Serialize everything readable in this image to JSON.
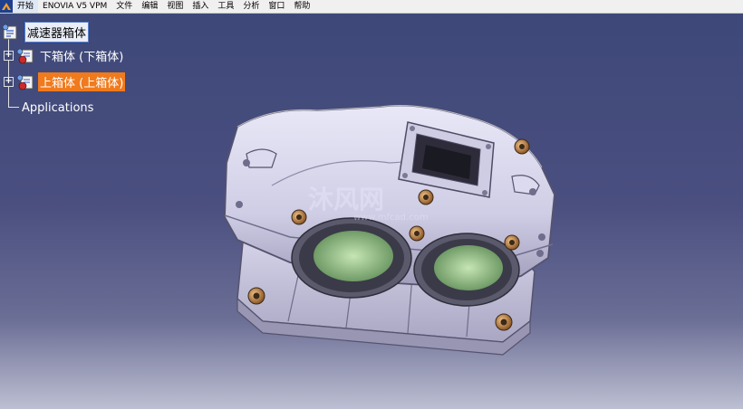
{
  "menubar": {
    "items": [
      "开始",
      "ENOVIA V5 VPM",
      "文件",
      "编辑",
      "视图",
      "插入",
      "工具",
      "分析",
      "窗口",
      "帮助"
    ]
  },
  "tree": {
    "root": "减速器箱体",
    "children": [
      {
        "label": "下箱体 (下箱体)",
        "selected": false
      },
      {
        "label": "上箱体 (上箱体)",
        "selected": true
      }
    ],
    "applications": "Applications"
  },
  "watermark": {
    "brand": "沐风网",
    "url": "www.mfcad.com"
  },
  "colors": {
    "background_top": "#3d4878",
    "background_bottom": "#bdbfd2",
    "selection": "#f07a1c",
    "housing": "#d8d6ec",
    "bore": "#9fc98c",
    "bolt": "#c98642"
  }
}
